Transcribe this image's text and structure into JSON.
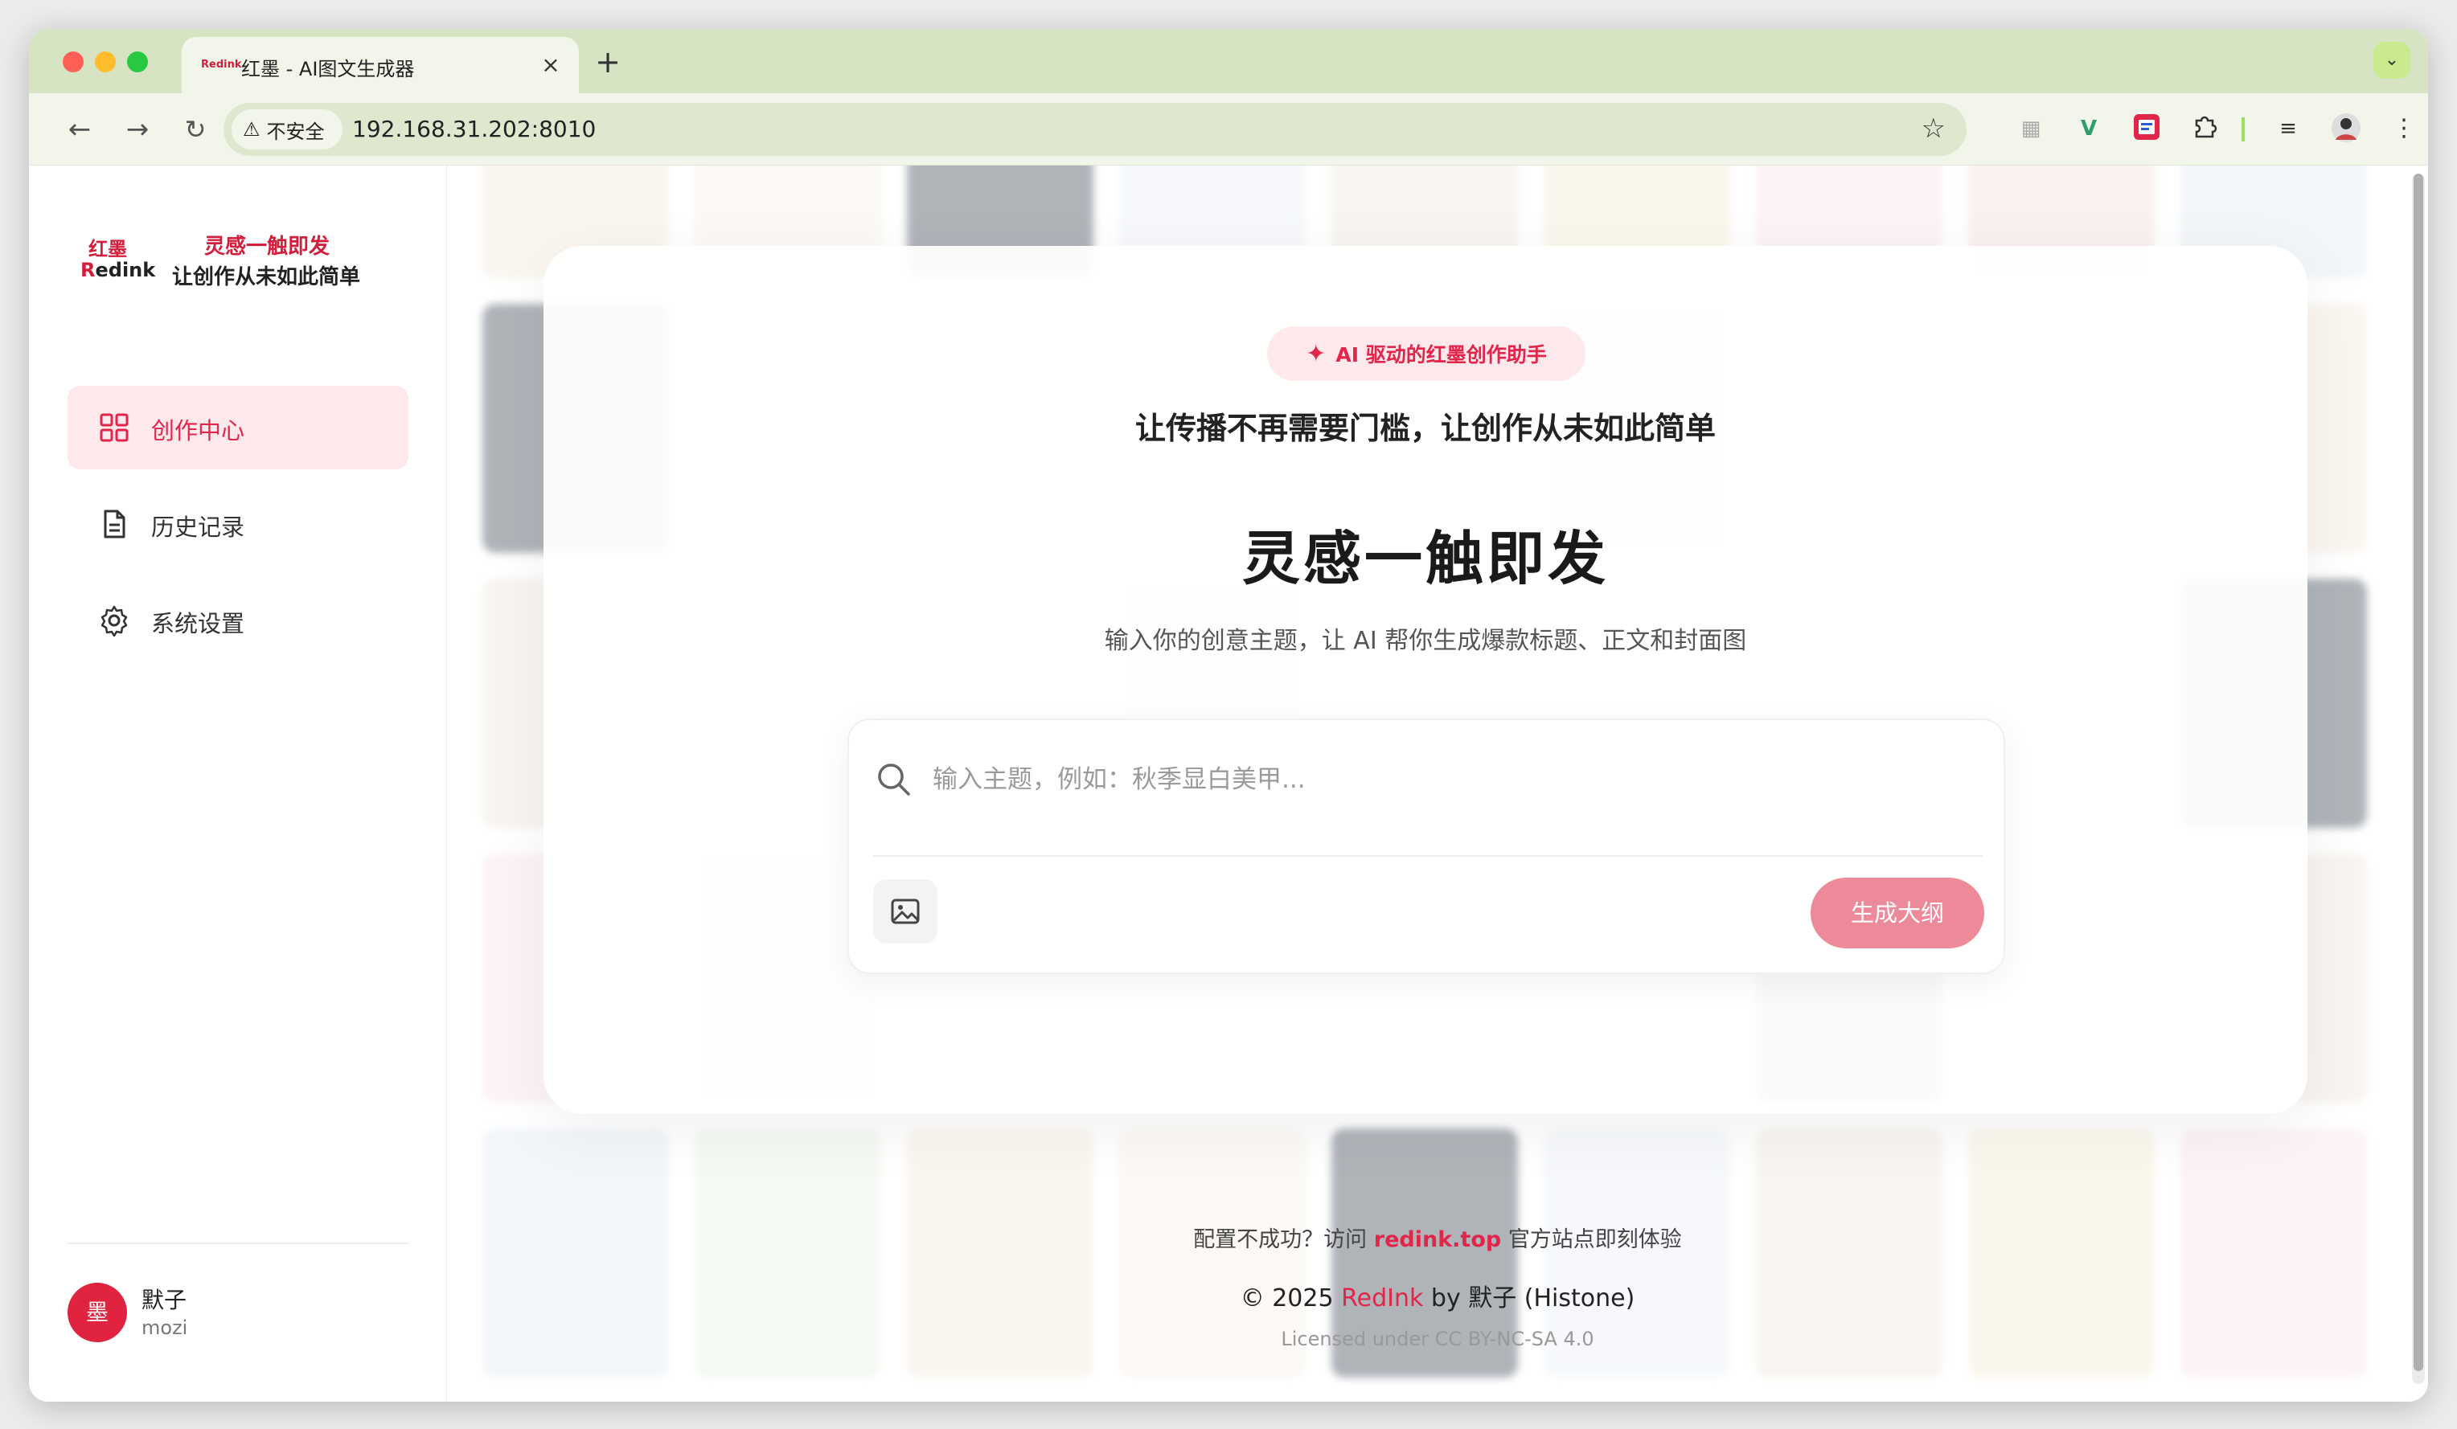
{
  "browser": {
    "tab_title": "红墨 - AI图文生成器",
    "tab_favicon": "Redink",
    "security_label": "不安全",
    "url": "192.168.31.202:8010"
  },
  "brand": {
    "logo_top": "红墨",
    "logo_bottom_r": "R",
    "logo_bottom_rest": "edink",
    "tagline1": "灵感一触即发",
    "tagline2": "让创作从未如此简单"
  },
  "sidebar": {
    "items": [
      {
        "label": "创作中心",
        "icon": "grid-icon",
        "active": true
      },
      {
        "label": "历史记录",
        "icon": "document-icon",
        "active": false
      },
      {
        "label": "系统设置",
        "icon": "gear-icon",
        "active": false
      }
    ],
    "user": {
      "avatar_text": "墨",
      "name": "默子",
      "handle": "mozi"
    }
  },
  "hero": {
    "badge": "AI 驱动的红墨创作助手",
    "subtitle": "让传播不再需要门槛，让创作从未如此简单",
    "title": "灵感一触即发",
    "description": "输入你的创意主题，让 AI 帮你生成爆款标题、正文和封面图"
  },
  "search": {
    "placeholder": "输入主题，例如：秋季显白美甲...",
    "value": "",
    "generate_label": "生成大纲"
  },
  "footer": {
    "line1_prefix": "配置不成功？访问",
    "line1_link": "redink.top",
    "line1_suffix": "官方站点即刻体验",
    "line2_prefix": "© 2025",
    "line2_brand": "RedInk",
    "line2_suffix": "by 默子 (Histone)",
    "line3": "Licensed under CC BY-NC-SA 4.0"
  },
  "colors": {
    "accent": "#e1264a",
    "accent_soft": "#fde8ec",
    "button_disabled": "#ec8a9a",
    "chrome": "#d6e4c3"
  }
}
